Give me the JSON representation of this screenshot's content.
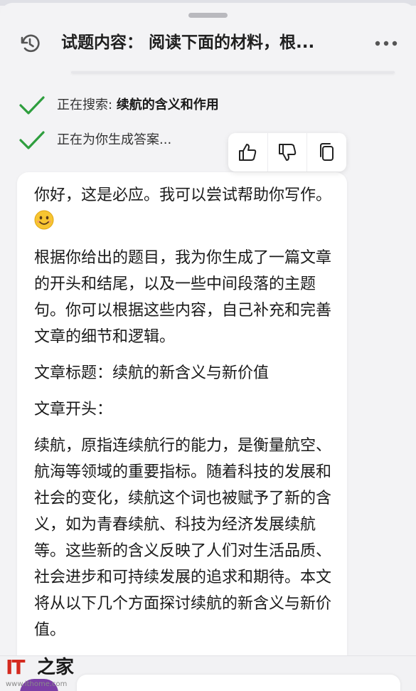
{
  "header": {
    "title": "试题内容： 阅读下面的材料，根..."
  },
  "status": [
    {
      "prefix": "正在搜索: ",
      "query": "续航的含义和作用"
    },
    {
      "prefix": "正在为你生成答案...",
      "query": ""
    }
  ],
  "feedback": {
    "thumbs_up": "thumbs-up-icon",
    "thumbs_down": "thumbs-down-icon",
    "copy": "copy-icon"
  },
  "answer": {
    "greeting": "你好，这是必应。我可以尝试帮助你写作。",
    "intro": "根据你给出的题目，我为你生成了一篇文章的开头和结尾，以及一些中间段落的主题句。你可以根据这些内容，自己补充和完善文章的细节和逻辑。",
    "article_title": "文章标题：续航的新含义与新价值",
    "opening_label": "文章开头：",
    "opening_text": "续航，原指连续航行的能力，是衡量航空、航海等领域的重要指标。随着科技的发展和社会的变化，续航这个词也被赋予了新的含义，如为青春续航、科技为经济发展续航等。这些新的含义反映了人们对生活品质、社会进步和可持续发展的追求和期待。本文将从以下几个方面探讨续航的新含义与新价值。"
  },
  "watermark": {
    "brand_latin": "IT",
    "brand_zh": "之家",
    "url": "www.ithome.com"
  },
  "colors": {
    "check": "#2e9e3e",
    "accent_watermark": "#d42a1f"
  }
}
